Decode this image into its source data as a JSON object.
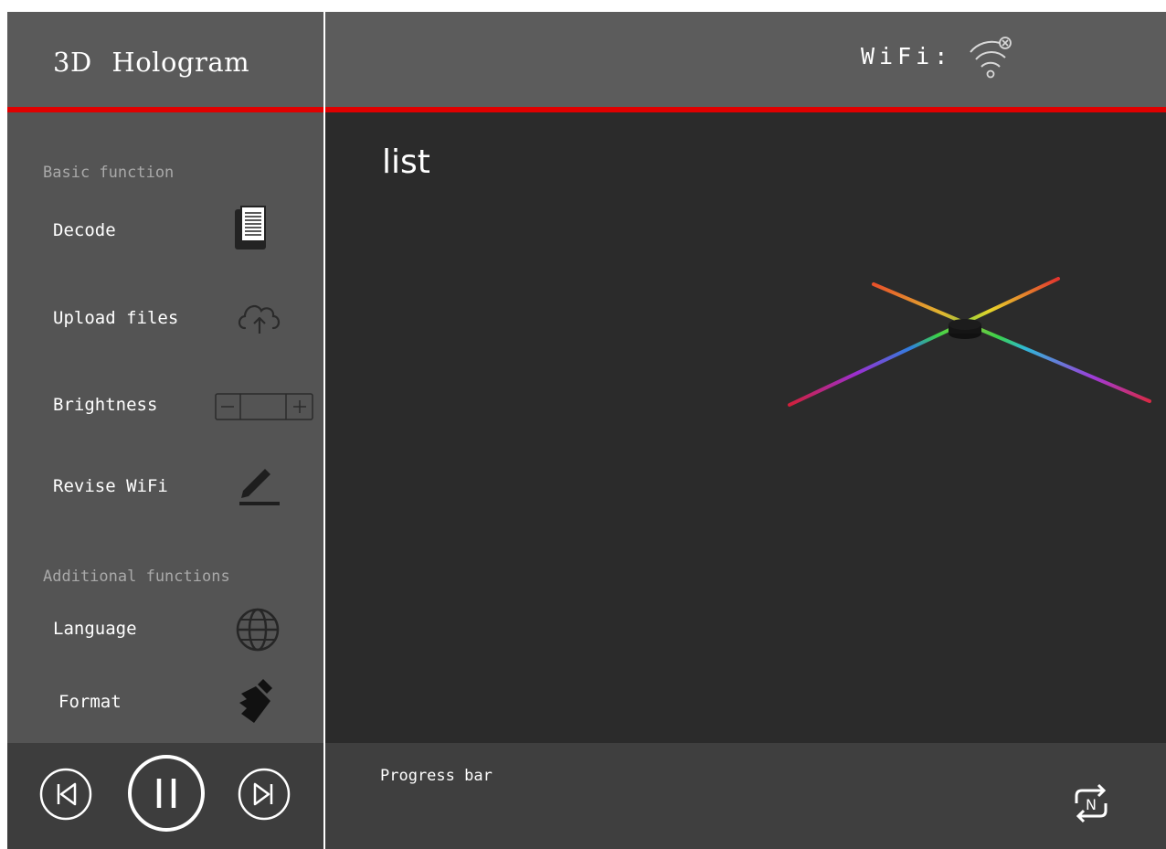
{
  "app": {
    "title": "3D Hologram"
  },
  "header": {
    "wifi_label": "WiFi:",
    "wifi_icon": "wifi-disconnected-icon"
  },
  "sidebar": {
    "basic_section": "Basic function",
    "additional_section": "Additional functions",
    "items": [
      {
        "label": "Decode",
        "icon": "document-icon"
      },
      {
        "label": "Upload files",
        "icon": "cloud-upload-icon"
      },
      {
        "label": "Brightness",
        "icon": "brightness-stepper"
      },
      {
        "label": "Revise WiFi",
        "icon": "edit-icon"
      },
      {
        "label": "Language",
        "icon": "globe-icon"
      },
      {
        "label": "Format",
        "icon": "brush-icon"
      }
    ]
  },
  "main": {
    "title": "list"
  },
  "player": {
    "previous_icon": "previous-track-icon",
    "pause_icon": "pause-icon",
    "next_icon": "next-track-icon"
  },
  "progress": {
    "label": "Progress bar",
    "loop_icon": "loop-mode-icon"
  },
  "colors": {
    "accent": "#e00000",
    "sidebar": "#545454",
    "main": "#2b2b2b",
    "header": "#5c5c5c"
  }
}
